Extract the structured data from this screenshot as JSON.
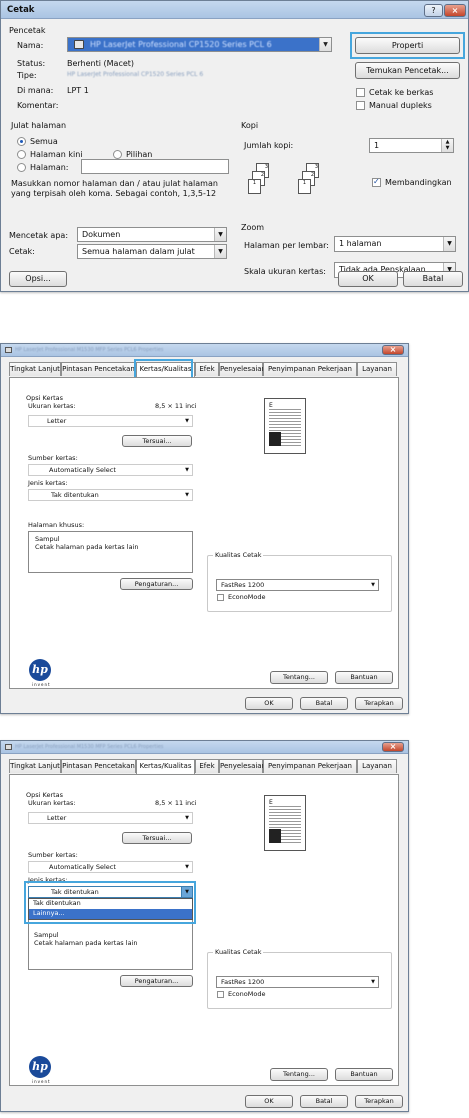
{
  "print": {
    "title": "Cetak",
    "help_label": "?",
    "close_label": "×",
    "printer_group": "Pencetak",
    "name_label": "Nama:",
    "printer_name": "HP LaserJet Professional CP1520 Series PCL 6",
    "properties_button": "Properti",
    "find_printer_button": "Temukan Pencetak...",
    "status_label": "Status:",
    "status_value": "Berhenti (Macet)",
    "type_label": "Tipe:",
    "type_value": "HP LaserJet Professional CP1520 Series PCL 6",
    "where_label": "Di mana:",
    "where_value": "LPT 1",
    "comment_label": "Komentar:",
    "print_to_file": "Cetak ke berkas",
    "manual_duplex": "Manual dupleks",
    "range_group": "Julat halaman",
    "range_all": "Semua",
    "range_current": "Halaman kini",
    "range_selection": "Pilihan",
    "range_pages": "Halaman:",
    "range_hint_1": "Masukkan nomor halaman dan / atau julat halaman",
    "range_hint_2": "yang terpisah oleh koma. Sebagai contoh, 1,3,5-12",
    "copies_group": "Kopi",
    "copies_label": "Jumlah kopi:",
    "copies_value": "1",
    "collate": "Membandingkan",
    "print_what_label": "Mencetak apa:",
    "print_what_value": "Dokumen",
    "print_label": "Cetak:",
    "print_value": "Semua halaman dalam julat",
    "zoom_group": "Zoom",
    "pages_per_sheet_label": "Halaman per lembar:",
    "pages_per_sheet_value": "1 halaman",
    "scale_label": "Skala ukuran kertas:",
    "scale_value": "Tidak ada Penskalaan",
    "options_button": "Opsi...",
    "ok_button": "OK",
    "cancel_button": "Batal"
  },
  "props": {
    "title": "HP LaserJet Professional M1530 MFP Series PCL6 Properties",
    "close_label": "×",
    "tabs": [
      "Tingkat Lanjut",
      "Pintasan Pencetakan",
      "Kertas/Kualitas",
      "Efek",
      "Penyelesaian",
      "Penyimpanan Pekerjaan",
      "Layanan"
    ],
    "paper_options": "Opsi Kertas",
    "paper_size_label": "Ukuran kertas:",
    "paper_size_dim": "8,5 × 11 inci",
    "paper_size_value": "Letter",
    "custom_button": "Tersuai...",
    "source_label": "Sumber kertas:",
    "source_value": "Automatically Select",
    "type_label": "Jenis kertas:",
    "type_value": "Tak ditentukan",
    "special_pages": "Halaman khusus:",
    "special_1": "Sampul",
    "special_2": "Cetak halaman pada kertas lain",
    "settings_button": "Pengaturan...",
    "quality_group": "Kualitas Cetak",
    "quality_value": "FastRes 1200",
    "economode": "EconoMode",
    "about_button": "Tentang...",
    "help_button": "Bantuan",
    "ok_button": "OK",
    "cancel_button": "Batal",
    "apply_button": "Terapkan",
    "hp_logo": "hp",
    "hp_tagline": "invent",
    "dropdown_options": [
      "Tak ditentukan",
      "Lainnya..."
    ]
  }
}
